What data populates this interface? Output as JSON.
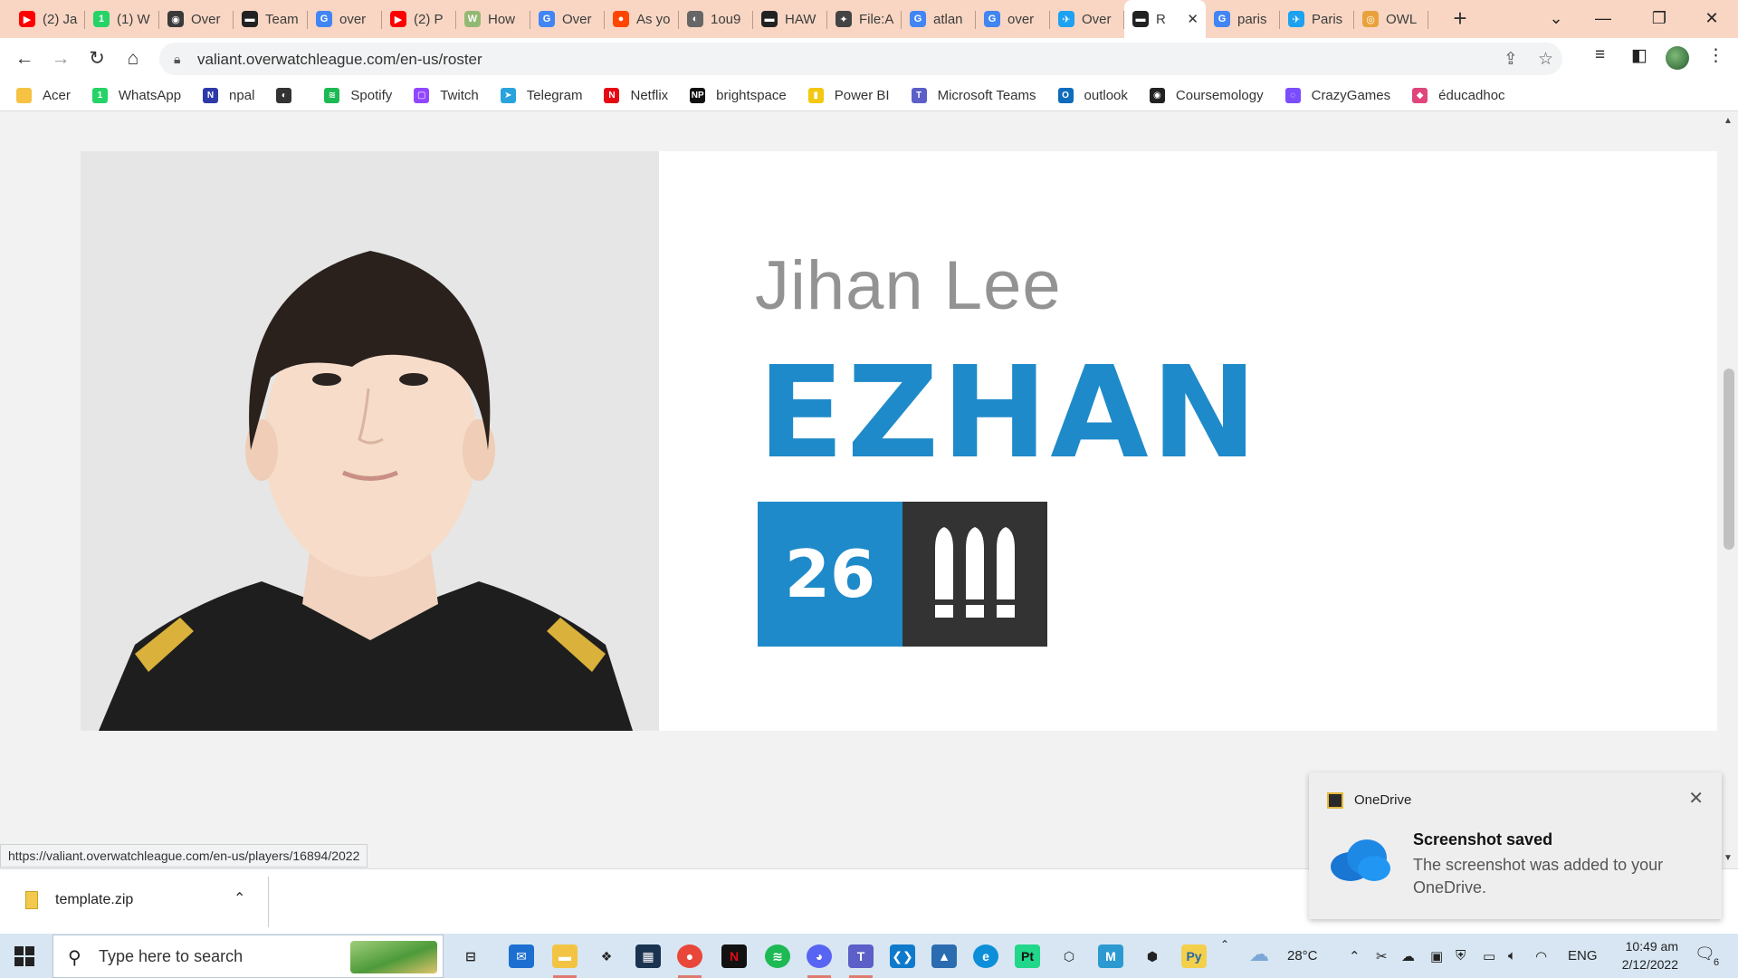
{
  "tabs": [
    {
      "label": "(2) Ja",
      "icon": "youtube-icon",
      "color": "#ff0000",
      "glyph": "▶"
    },
    {
      "label": "(1) W",
      "icon": "whatsapp-icon",
      "color": "#25d366",
      "glyph": "1"
    },
    {
      "label": "Over",
      "icon": "overwatch-icon",
      "color": "#3a3a3a",
      "glyph": "◉"
    },
    {
      "label": "Team",
      "icon": "owl-icon",
      "color": "#222222",
      "glyph": "▬"
    },
    {
      "label": "over",
      "icon": "google-icon",
      "color": "#4285f4",
      "glyph": "G"
    },
    {
      "label": "(2) P",
      "icon": "youtube-icon",
      "color": "#ff0000",
      "glyph": "▶"
    },
    {
      "label": "How",
      "icon": "wikihow-icon",
      "color": "#93b874",
      "glyph": "W"
    },
    {
      "label": "Over",
      "icon": "google-icon",
      "color": "#4285f4",
      "glyph": "G"
    },
    {
      "label": "As yo",
      "icon": "reddit-icon",
      "color": "#ff4500",
      "glyph": "●"
    },
    {
      "label": "1ou9",
      "icon": "globe-icon",
      "color": "#666666",
      "glyph": "◐"
    },
    {
      "label": "HAW",
      "icon": "owl-icon",
      "color": "#222222",
      "glyph": "▬"
    },
    {
      "label": "File:A",
      "icon": "wiki-icon",
      "color": "#444444",
      "glyph": "✦"
    },
    {
      "label": "atlan",
      "icon": "google-icon",
      "color": "#4285f4",
      "glyph": "G"
    },
    {
      "label": "over",
      "icon": "google-icon",
      "color": "#4285f4",
      "glyph": "G"
    },
    {
      "label": "Over",
      "icon": "twitter-icon",
      "color": "#1da1f2",
      "glyph": "✈"
    },
    {
      "label": "R",
      "icon": "owl-icon",
      "color": "#222222",
      "glyph": "▬",
      "active": true
    },
    {
      "label": "paris",
      "icon": "google-icon",
      "color": "#4285f4",
      "glyph": "G"
    },
    {
      "label": "Paris",
      "icon": "twitter-icon",
      "color": "#1da1f2",
      "glyph": "✈"
    },
    {
      "label": "OWL",
      "icon": "owl-coin-icon",
      "color": "#e9a23b",
      "glyph": "◎"
    }
  ],
  "address": {
    "url": "valiant.overwatchleague.com/en-us/roster"
  },
  "bookmarks": [
    {
      "label": "Acer",
      "icon": "folder-icon",
      "color": "#f6c244",
      "glyph": ""
    },
    {
      "label": "WhatsApp",
      "icon": "whatsapp-icon",
      "color": "#25d366",
      "glyph": "1"
    },
    {
      "label": "npal",
      "icon": "npal-icon",
      "color": "#2d3aa8",
      "glyph": "N"
    },
    {
      "label": "",
      "icon": "globe-icon",
      "color": "#333333",
      "glyph": "◐"
    },
    {
      "label": "Spotify",
      "icon": "spotify-icon",
      "color": "#1db954",
      "glyph": "≋"
    },
    {
      "label": "Twitch",
      "icon": "twitch-icon",
      "color": "#9146ff",
      "glyph": "▢"
    },
    {
      "label": "Telegram",
      "icon": "telegram-icon",
      "color": "#2aa3dd",
      "glyph": "➤"
    },
    {
      "label": "Netflix",
      "icon": "netflix-icon",
      "color": "#e50914",
      "glyph": "N"
    },
    {
      "label": "brightspace",
      "icon": "np-icon",
      "color": "#111111",
      "glyph": "NP"
    },
    {
      "label": "Power BI",
      "icon": "powerbi-icon",
      "color": "#f2c811",
      "glyph": "▮"
    },
    {
      "label": "Microsoft Teams",
      "icon": "teams-icon",
      "color": "#5b5fc7",
      "glyph": "T"
    },
    {
      "label": "outlook",
      "icon": "outlook-icon",
      "color": "#0f6cbd",
      "glyph": "O"
    },
    {
      "label": "Coursemology",
      "icon": "coursemology-icon",
      "color": "#222222",
      "glyph": "◉"
    },
    {
      "label": "CrazyGames",
      "icon": "crazygames-icon",
      "color": "#7b4dff",
      "glyph": "◌"
    },
    {
      "label": "éducadhoc",
      "icon": "educadhoc-icon",
      "color": "#e0457b",
      "glyph": "◆"
    }
  ],
  "player": {
    "given_name": "Jihan Lee",
    "handle": "EZHAN",
    "number": "26",
    "role_icon": "damage-role-icon"
  },
  "status_url": "https://valiant.overwatchleague.com/en-us/players/16894/2022",
  "toast": {
    "app": "OneDrive",
    "title": "Screenshot saved",
    "message": "The screenshot was added to your OneDrive."
  },
  "download": {
    "filename": "template.zip"
  },
  "taskbar": {
    "search_placeholder": "Type here to search",
    "weather": "28°C",
    "language": "ENG",
    "time": "10:49 am",
    "date": "2/12/2022",
    "notification_count": "6"
  },
  "colors": {
    "accent_blue": "#1f8ac9",
    "role_box": "#333333",
    "tab_strip": "#f8d6c3"
  }
}
